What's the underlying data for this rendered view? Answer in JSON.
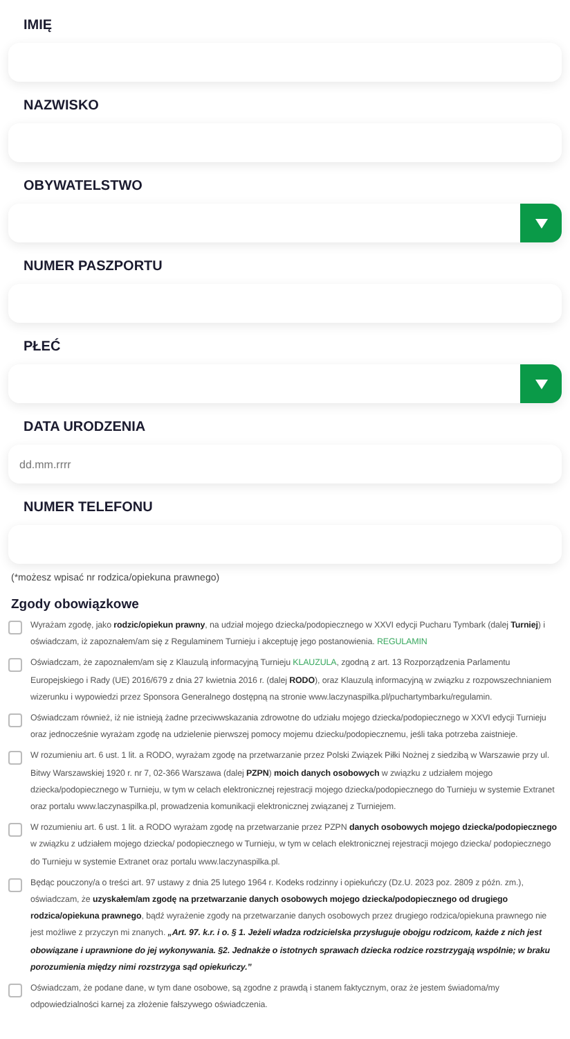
{
  "fields": [
    {
      "label": "IMIĘ",
      "kind": "text"
    },
    {
      "label": "NAZWISKO",
      "kind": "text"
    },
    {
      "label": "OBYWATELSTWO",
      "kind": "select"
    },
    {
      "label": "NUMER PASZPORTU",
      "kind": "text"
    },
    {
      "label": "PŁEĆ",
      "kind": "select"
    },
    {
      "label": "DATA URODZENIA",
      "kind": "date",
      "placeholder": "dd.mm.rrrr"
    },
    {
      "label": "NUMER TELEFONU",
      "kind": "text"
    }
  ],
  "phone_note": "(*możesz wpisać nr rodzica/opiekuna prawnego)",
  "consents_heading": "Zgody obowiązkowe",
  "consents": [
    {
      "checked": false,
      "parts": [
        {
          "kind": "text",
          "text": "Wyrażam zgodę, jako **rodzic/opiekun prawny**, na udział mojego dziecka/podopiecznego w XXVI edycji Pucharu Tymbark (dalej **Turniej**) i oświadczam, iż zapoznałem/am się z Regulaminem Turnieju i akceptuję jego postanowienia. "
        },
        {
          "kind": "link",
          "text": "REGULAMIN"
        }
      ]
    },
    {
      "checked": false,
      "parts": [
        {
          "kind": "text",
          "text": "Oświadczam, że zapoznałem/am się z Klauzulą informacyjną Turnieju "
        },
        {
          "kind": "link",
          "text": "KLAUZULA"
        },
        {
          "kind": "text",
          "text": ", zgodną z art. 13 Rozporządzenia Parlamentu Europejskiego i Rady (UE) 2016/679 z dnia 27 kwietnia 2016 r. (dalej **RODO**), oraz Klauzulą informacyjną w związku z rozpowszechnianiem wizerunku i wypowiedzi przez Sponsora Generalnego dostępną na stronie www.laczynaspilka.pl/puchartymbarku/regulamin."
        }
      ]
    },
    {
      "checked": false,
      "parts": [
        {
          "kind": "text",
          "text": "Oświadczam również, iż nie istnieją żadne przeciwwskazania zdrowotne do udziału mojego dziecka/podopiecznego w XXVI edycji Turnieju oraz jednocześnie wyrażam zgodę na udzielenie pierwszej pomocy mojemu dziecku/podopiecznemu, jeśli taka potrzeba zaistnieje."
        }
      ]
    },
    {
      "checked": false,
      "parts": [
        {
          "kind": "text",
          "text": "W rozumieniu art. 6 ust. 1 lit. a RODO, wyrażam zgodę na przetwarzanie przez Polski Związek Piłki Nożnej z siedzibą w Warszawie przy ul. Bitwy Warszawskiej 1920 r. nr 7, 02-366 Warszawa (dalej **PZPN**) **moich danych osobowych** w związku z udziałem mojego dziecka/podopiecznego w Turnieju, w tym w celach elektronicznej rejestracji mojego dziecka/podopiecznego do Turnieju w systemie Extranet oraz portalu www.laczynaspilka.pl, prowadzenia komunikacji elektronicznej związanej z Turniejem."
        }
      ]
    },
    {
      "checked": false,
      "parts": [
        {
          "kind": "text",
          "text": "W rozumieniu art. 6 ust. 1 lit. a RODO wyrażam zgodę na przetwarzanie przez PZPN **danych osobowych mojego dziecka/podopiecznego** w związku z udziałem mojego dziecka/ podopiecznego w Turnieju, w tym w celach elektronicznej rejestracji mojego dziecka/ podopiecznego do Turnieju w systemie Extranet oraz portalu www.laczynaspilka.pl."
        }
      ]
    },
    {
      "checked": false,
      "parts": [
        {
          "kind": "text",
          "text": "Będąc pouczony/a o treści art. 97 ustawy z dnia 25 lutego 1964 r. Kodeks rodzinny i opiekuńczy (Dz.U. 2023 poz. 2809 z późn. zm.), oświadczam, że **uzyskałem/am zgodę na przetwarzanie danych osobowych mojego dziecka/podopiecznego od drugiego rodzica/opiekuna prawnego**, bądź wyrażenie zgody na przetwarzanie danych osobowych przez drugiego rodzica/opiekuna prawnego nie jest możliwe z przyczyn mi znanych. "
        },
        {
          "kind": "quote",
          "text": "„Art. 97. k.r. i o. § 1. Jeżeli władza rodzicielska przysługuje obojgu rodzicom, każde z nich jest obowiązane i uprawnione do jej wykonywania. §2. Jednakże o istotnych sprawach dziecka rodzice rozstrzygają wspólnie; w braku porozumienia między nimi rozstrzyga sąd opiekuńczy.”"
        }
      ]
    },
    {
      "checked": false,
      "parts": [
        {
          "kind": "text",
          "text": "Oświadczam, że podane dane, w tym dane osobowe, są zgodne z prawdą i stanem faktycznym, oraz że jestem świadoma/my odpowiedzialności karnej za złożenie fałszywego oświadczenia."
        }
      ]
    }
  ]
}
